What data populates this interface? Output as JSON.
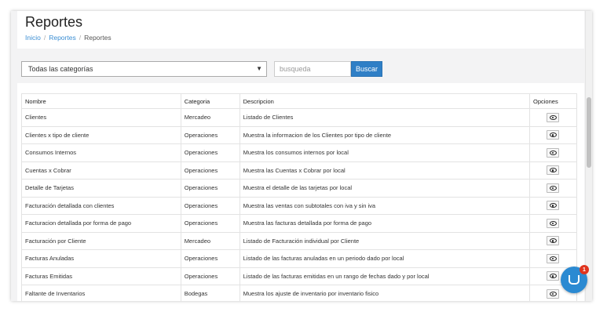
{
  "page": {
    "title": "Reportes",
    "breadcrumb": [
      "Inicio",
      "Reportes",
      "Reportes"
    ]
  },
  "filters": {
    "category_selected": "Todas las categorías",
    "search_placeholder": "busqueda",
    "search_button": "Buscar"
  },
  "table": {
    "headers": [
      "Nombre",
      "Categoria",
      "Descripcion",
      "Opciones"
    ],
    "rows": [
      [
        "Clientes",
        "Mercadeo",
        "Listado de Clientes"
      ],
      [
        "Clientes x tipo de cliente",
        "Operaciones",
        "Muestra la informacion de los Clientes por tipo de cliente"
      ],
      [
        "Consumos Internos",
        "Operaciones",
        "Muestra los consumos internos por local"
      ],
      [
        "Cuentas x Cobrar",
        "Operaciones",
        "Muestra las Cuentas x Cobrar por local"
      ],
      [
        "Detalle de Tarjetas",
        "Operaciones",
        "Muestra el detalle de las tarjetas por local"
      ],
      [
        "Facturación detallada con clientes",
        "Operaciones",
        "Muestra las ventas con subtotales con iva y sin iva"
      ],
      [
        "Facturacion detallada por forma de pago",
        "Operaciones",
        "Muestra las facturas detallada por forma de pago"
      ],
      [
        "Facturación por Cliente",
        "Mercadeo",
        "Listado de Facturación individual por Cliente"
      ],
      [
        "Facturas Anuladas",
        "Operaciones",
        "Listado de las facturas anuladas en un periodo dado por local"
      ],
      [
        "Facturas Emitidas",
        "Operaciones",
        "Listado de las facturas emitidas en un rango de fechas dado y por local"
      ],
      [
        "Faltante de Inventarios",
        "Bodegas",
        "Muestra los ajuste de inventario por inventario fisico"
      ]
    ]
  },
  "chat": {
    "badge_count": "1",
    "icon": "chat-icon"
  },
  "colors": {
    "accent": "#2f7fc6",
    "badge": "#e0341e"
  }
}
